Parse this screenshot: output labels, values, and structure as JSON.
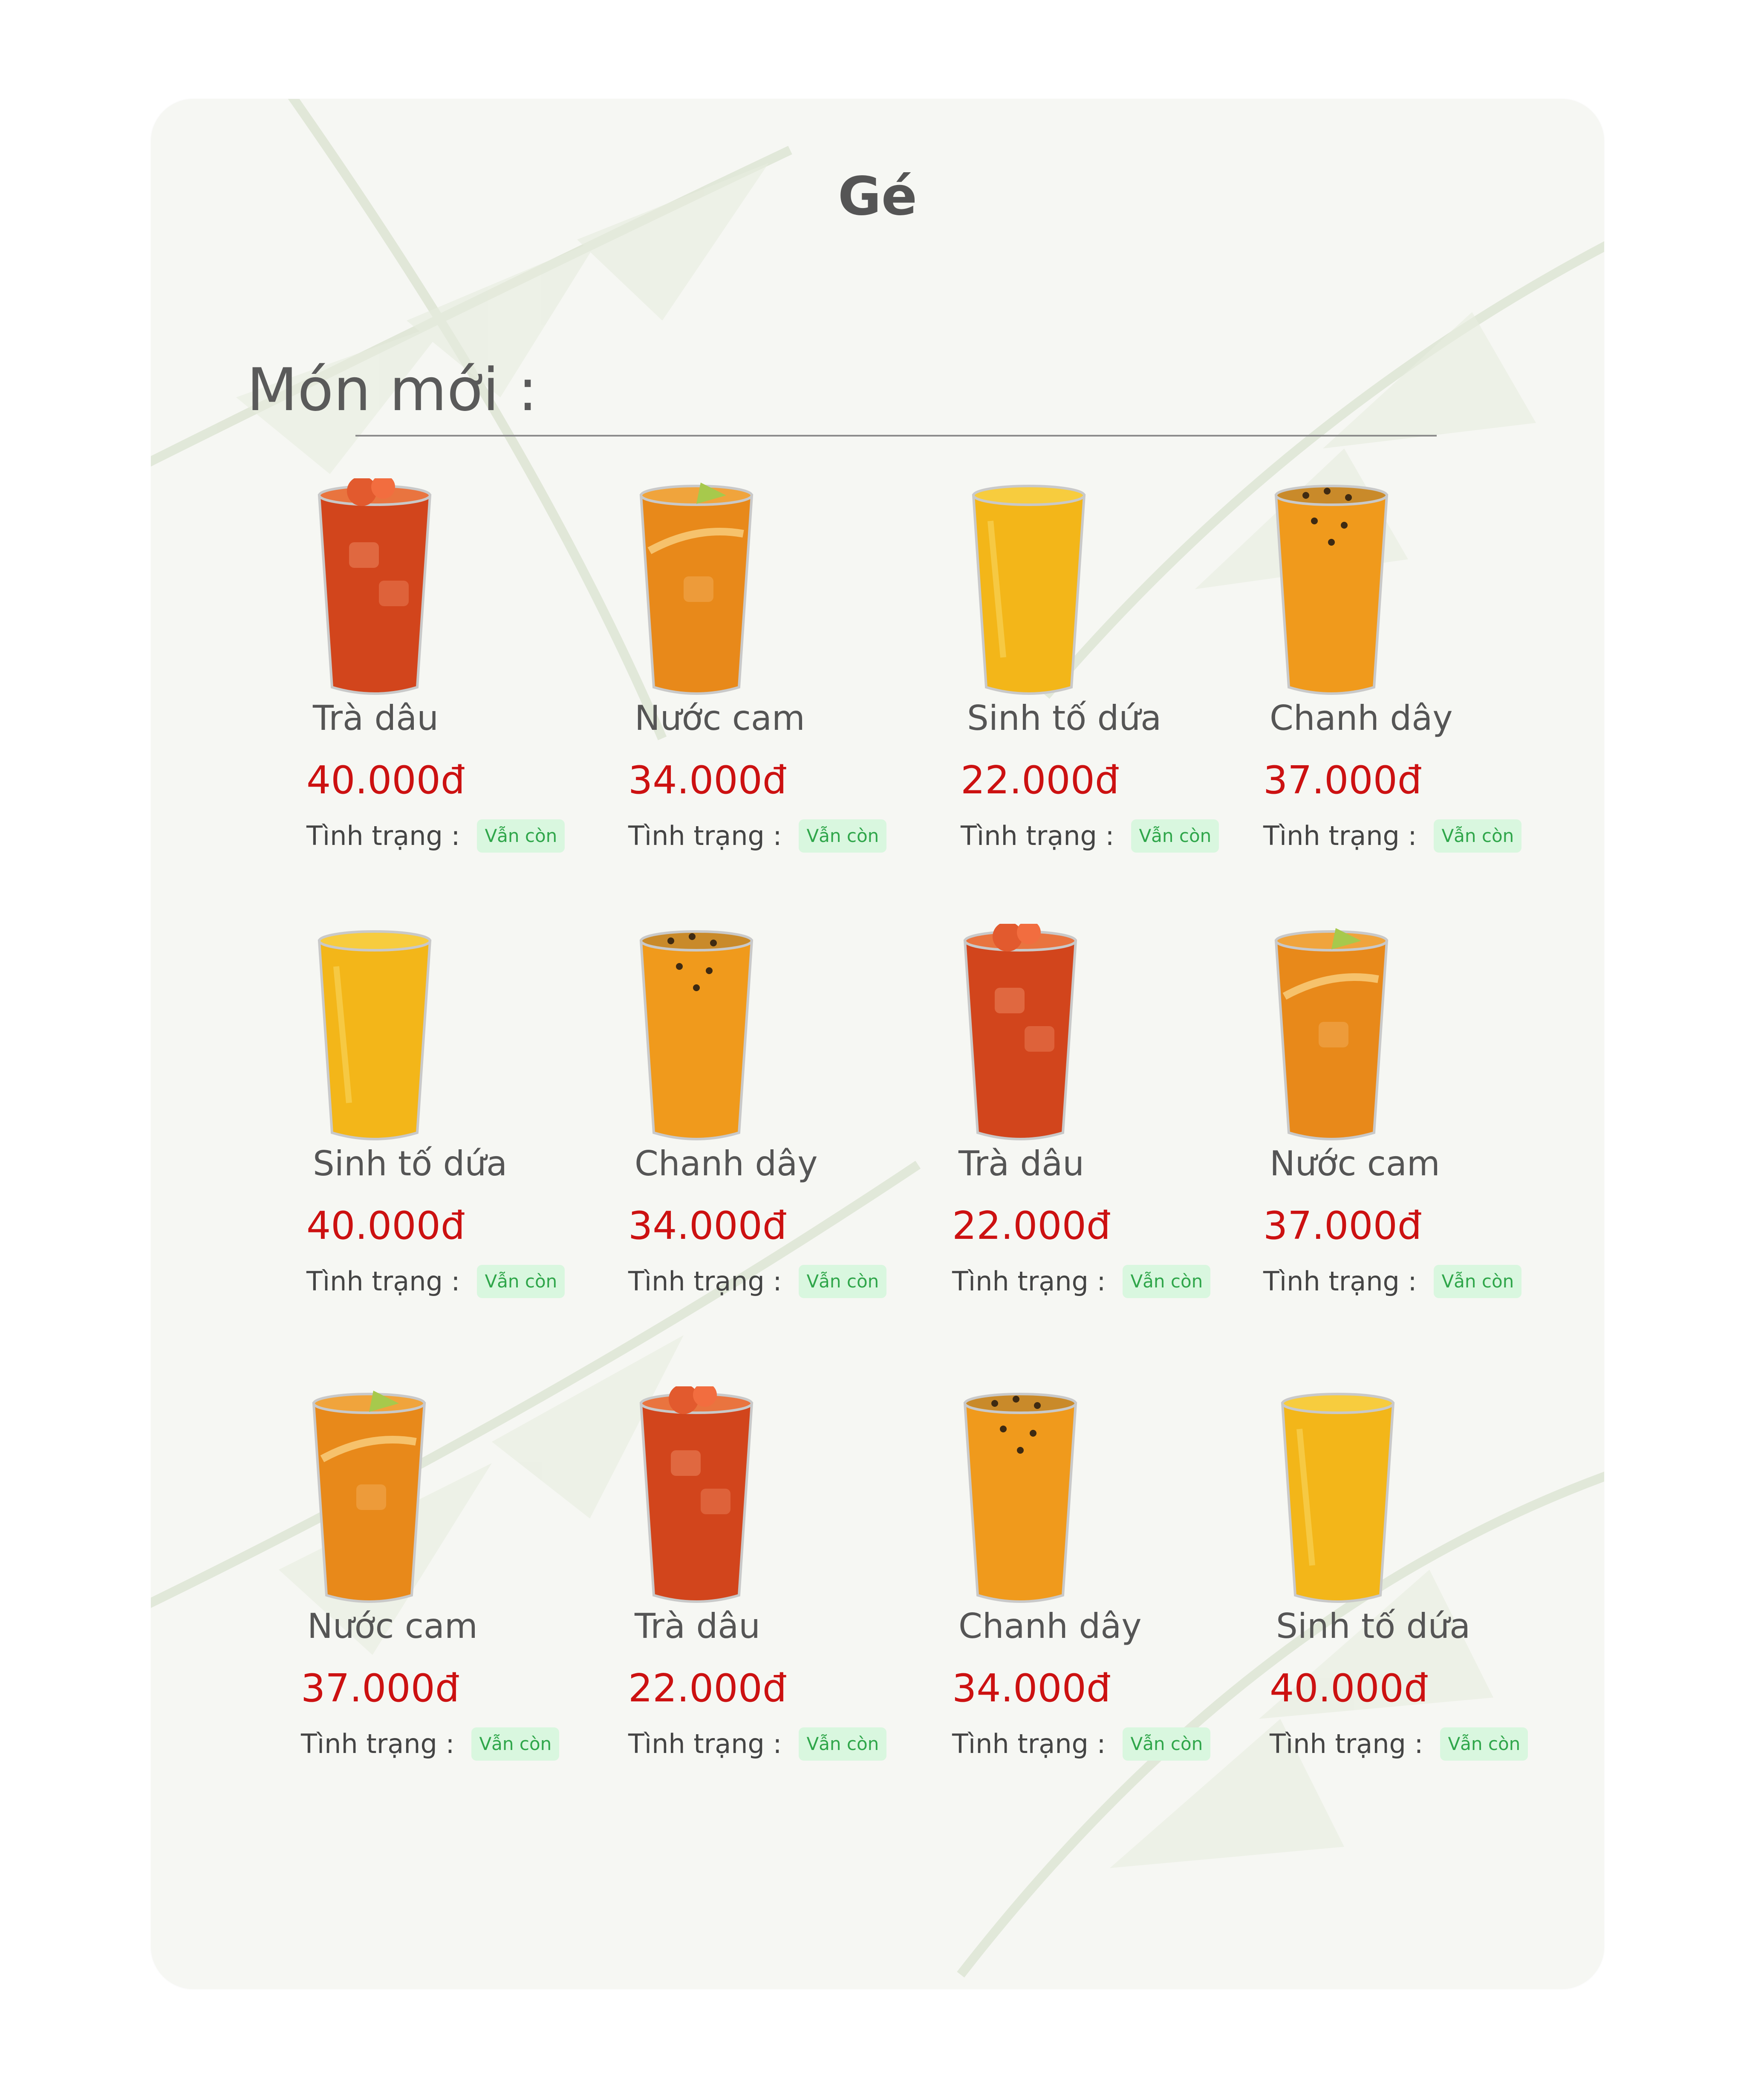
{
  "page": {
    "title": "Gé"
  },
  "section": {
    "title": "Món mới :"
  },
  "colors": {
    "price": "#cc1111",
    "badge_bg": "#d9f7df",
    "badge_text": "#2fa64a",
    "tea": "#d2451c",
    "orange": "#e8891a",
    "pineapple": "#f3b619",
    "passion": "#f09a1c"
  },
  "products": [
    {
      "name": "Trà dâu",
      "price": "40.000đ",
      "status_label": "Tình trạng :",
      "status": "Vẫn còn",
      "drink_icon": "strawberry-tea-glass"
    },
    {
      "name": "Nước cam",
      "price": "34.000đ",
      "status_label": "Tình trạng :",
      "status": "Vẫn còn",
      "drink_icon": "orange-juice-glass"
    },
    {
      "name": "Sinh tố dứa",
      "price": "22.000đ",
      "status_label": "Tình trạng :",
      "status": "Vẫn còn",
      "drink_icon": "pineapple-smoothie-glass"
    },
    {
      "name": "Chanh dây",
      "price": "37.000đ",
      "status_label": "Tình trạng :",
      "status": "Vẫn còn",
      "drink_icon": "passion-fruit-glass"
    },
    {
      "name": "Sinh tố dứa",
      "price": "40.000đ",
      "status_label": "Tình trạng :",
      "status": "Vẫn còn",
      "drink_icon": "pineapple-smoothie-glass"
    },
    {
      "name": "Chanh dây",
      "price": "34.000đ",
      "status_label": "Tình trạng :",
      "status": "Vẫn còn",
      "drink_icon": "passion-fruit-glass"
    },
    {
      "name": "Trà dâu",
      "price": "22.000đ",
      "status_label": "Tình trạng :",
      "status": "Vẫn còn",
      "drink_icon": "strawberry-tea-glass"
    },
    {
      "name": "Nước cam",
      "price": "37.000đ",
      "status_label": "Tình trạng :",
      "status": "Vẫn còn",
      "drink_icon": "orange-juice-glass"
    },
    {
      "name": "Nước cam",
      "price": "37.000đ",
      "status_label": "Tình trạng :",
      "status": "Vẫn còn",
      "drink_icon": "orange-juice-glass"
    },
    {
      "name": "Trà dâu",
      "price": "22.000đ",
      "status_label": "Tình trạng :",
      "status": "Vẫn còn",
      "drink_icon": "strawberry-tea-glass"
    },
    {
      "name": "Chanh dây",
      "price": "34.000đ",
      "status_label": "Tình trạng :",
      "status": "Vẫn còn",
      "drink_icon": "passion-fruit-glass"
    },
    {
      "name": "Sinh tố dứa",
      "price": "40.000đ",
      "status_label": "Tình trạng :",
      "status": "Vẫn còn",
      "drink_icon": "pineapple-smoothie-glass"
    }
  ]
}
